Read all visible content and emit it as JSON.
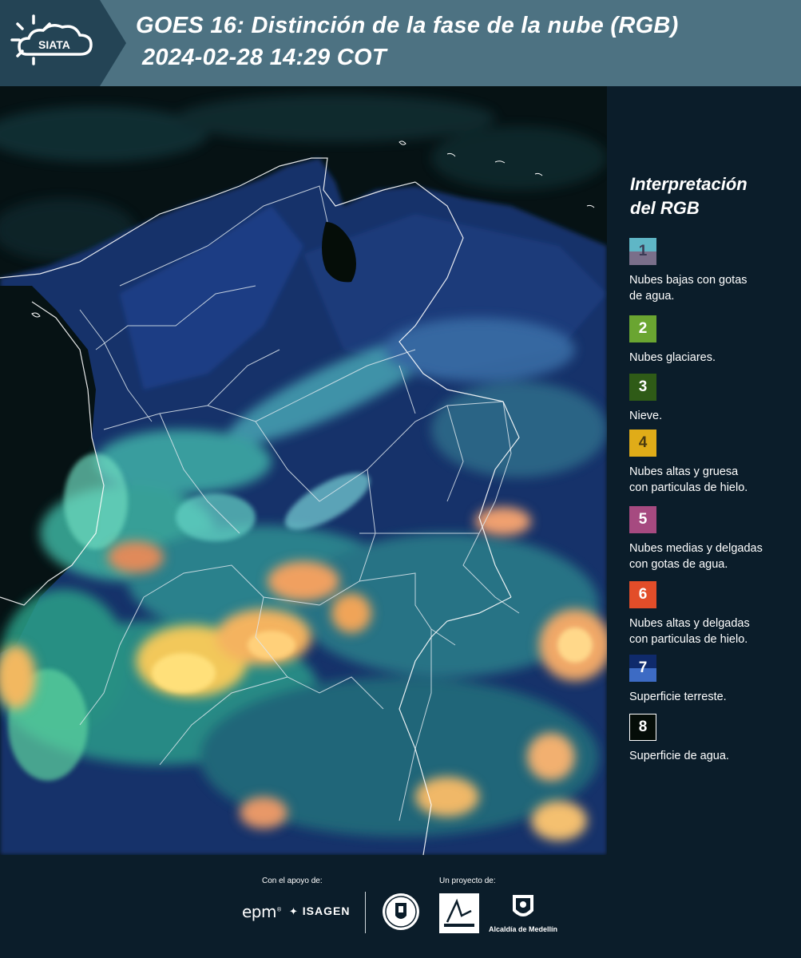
{
  "header": {
    "logo_text": "SIATA",
    "title_line1": "GOES 16: Distinción de la fase de la nube (RGB)",
    "title_line2": "2024-02-28 14:29 COT"
  },
  "legend": {
    "title_line1": "Interpretación",
    "title_line2": "del RGB",
    "items": [
      {
        "number": "1",
        "label_line1": "Nubes bajas con gotas",
        "label_line2": "de agua.",
        "color_top": "#5fb6c6",
        "color_bottom": "#7a6f8a"
      },
      {
        "number": "2",
        "label_line1": "Nubes glaciares.",
        "label_line2": "",
        "color_top": "#6aa531",
        "color_bottom": "#6aa531"
      },
      {
        "number": "3",
        "label_line1": "Nieve.",
        "label_line2": "",
        "color_top": "#2f5b17",
        "color_bottom": "#2f5b17"
      },
      {
        "number": "4",
        "label_line1": "Nubes altas y gruesa",
        "label_line2": "con particulas de hielo.",
        "color_top": "#e0ac18",
        "color_bottom": "#e0ac18"
      },
      {
        "number": "5",
        "label_line1": "Nubes medias y delgadas",
        "label_line2": "con gotas de agua.",
        "color_top": "#a64a80",
        "color_bottom": "#a64a80"
      },
      {
        "number": "6",
        "label_line1": "Nubes altas y delgadas",
        "label_line2": "con particulas de hielo.",
        "color_top": "#e24d29",
        "color_bottom": "#e24d29"
      },
      {
        "number": "7",
        "label_line1": "Superficie terreste.",
        "label_line2": "",
        "color_top": "#0f2a6b",
        "color_bottom": "#3d6bc4"
      },
      {
        "number": "8",
        "label_line1": "Superficie de agua.",
        "label_line2": "",
        "color_top": "#050d08",
        "color_bottom": "#050d08"
      }
    ]
  },
  "footer": {
    "support_label": "Con el apoyo de:",
    "project_label": "Un proyecto de:",
    "epm_text": "epm",
    "isagen_text": "ISAGEN",
    "alcaldia_text": "Alcaldía de Medellín"
  }
}
